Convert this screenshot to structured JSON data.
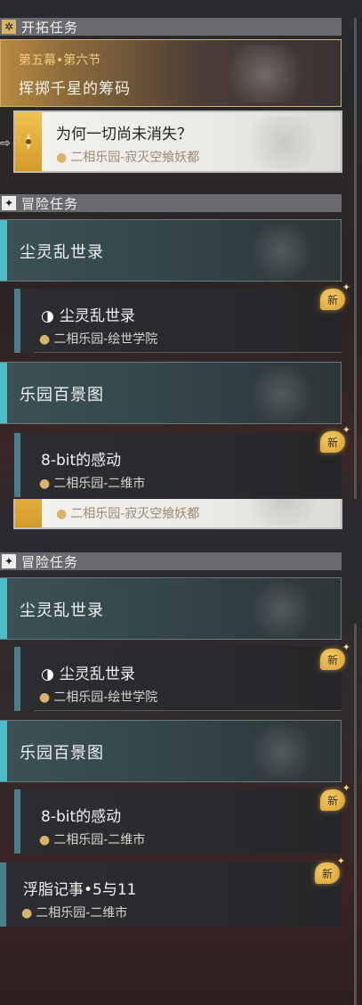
{
  "pioneer_section": {
    "title": "开拓任务",
    "icon": "diamond-icon"
  },
  "main_quest": {
    "chapter": "第五幕•第六节",
    "name": "挥掷千星的筹码"
  },
  "selected_task": {
    "name": "为何一切尚未消失？",
    "location": "二相乐园-寂灭空飨妖都"
  },
  "adventure_section": {
    "title": "冒险任务",
    "icon": "diamond-icon"
  },
  "categories": [
    {
      "name": "尘灵乱世录"
    },
    {
      "name": "乐园百景图"
    }
  ],
  "tasks": [
    {
      "name": "尘灵乱世录",
      "location": "二相乐园-绘世学院",
      "badge": "新",
      "icon": "dust-spirit-icon"
    },
    {
      "name": "8-bit的感动",
      "location": "二相乐园-二维市",
      "badge": "新"
    },
    {
      "name": "浮脂记事•5与11",
      "location": "二相乐园-二维市",
      "badge": "新"
    }
  ],
  "colors": {
    "gold": "#d7b46a",
    "teal": "#50bccb",
    "badge": "#e8b04a"
  }
}
